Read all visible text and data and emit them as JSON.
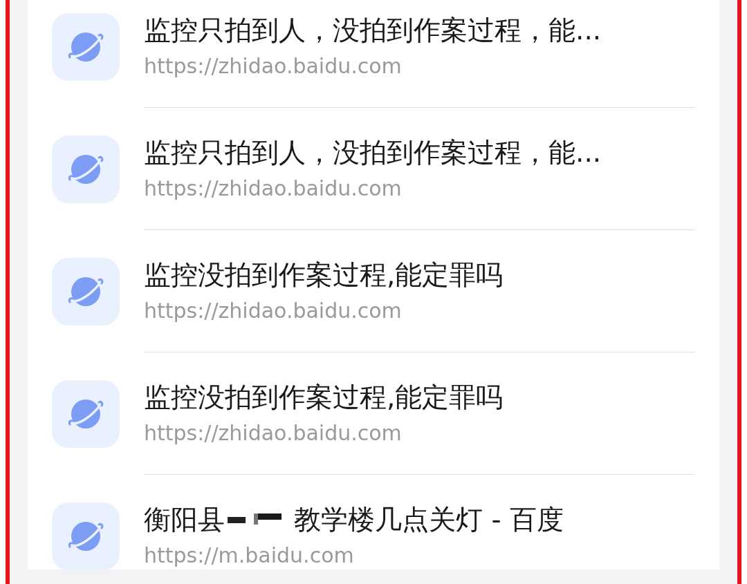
{
  "history": [
    {
      "title_parts": [
        {
          "kind": "text",
          "text": "监控只拍到人，没拍到作案过程，能..."
        }
      ],
      "url": "https://zhidao.baidu.com"
    },
    {
      "title_parts": [
        {
          "kind": "text",
          "text": "监控只拍到人，没拍到作案过程，能..."
        }
      ],
      "url": "https://zhidao.baidu.com"
    },
    {
      "title_parts": [
        {
          "kind": "text",
          "text": "监控没拍到作案过程,能定罪吗"
        }
      ],
      "url": "https://zhidao.baidu.com"
    },
    {
      "title_parts": [
        {
          "kind": "text",
          "text": "监控没拍到作案过程,能定罪吗"
        }
      ],
      "url": "https://zhidao.baidu.com"
    },
    {
      "title_parts": [
        {
          "kind": "text",
          "text": "衡阳县"
        },
        {
          "kind": "redacted"
        },
        {
          "kind": "text",
          "text": "教学楼几点关灯 - 百度"
        }
      ],
      "url": "https://m.baidu.com"
    }
  ]
}
